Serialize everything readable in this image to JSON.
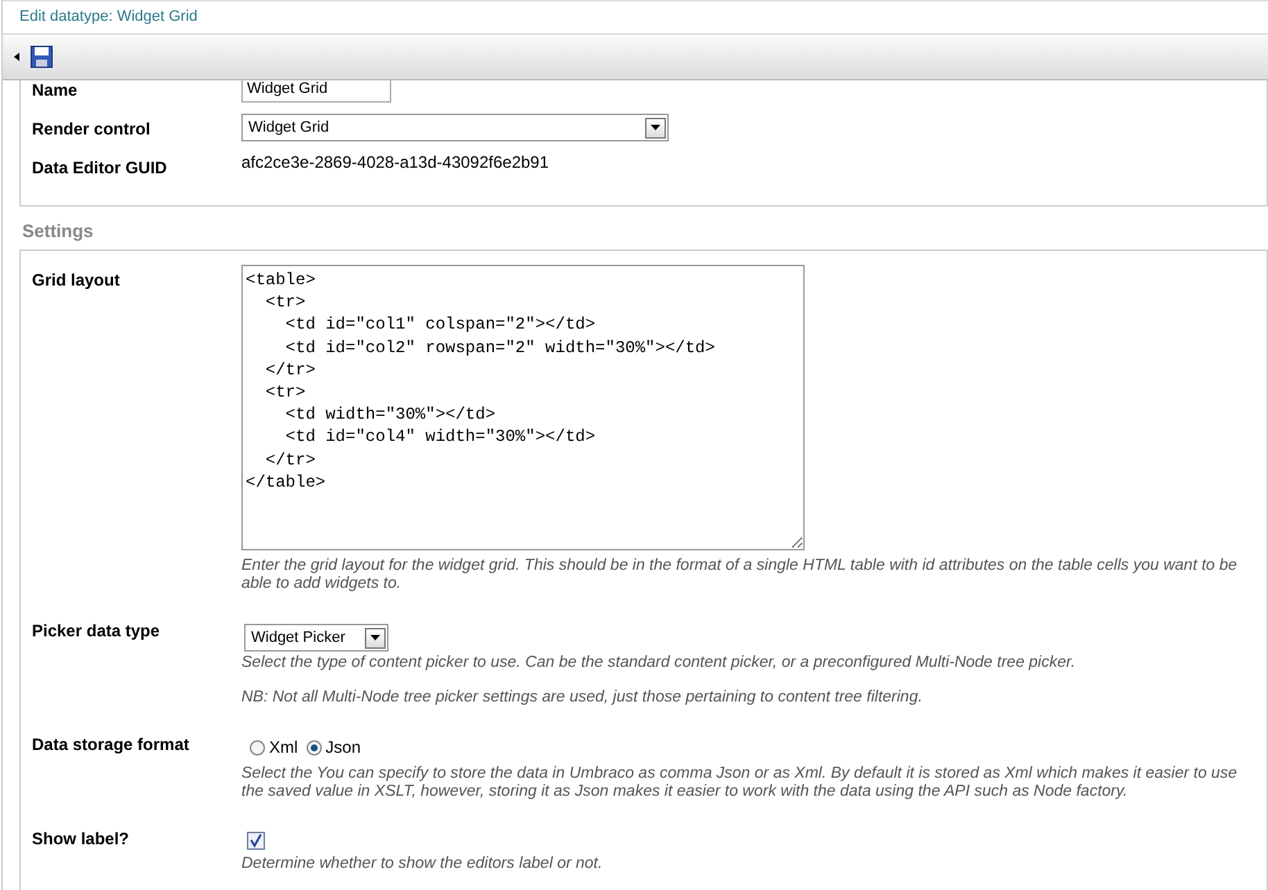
{
  "window": {
    "title": "Edit datatype: Widget Grid"
  },
  "general": [
    {
      "kind": "text",
      "label": "Name",
      "value": "Widget Grid"
    },
    {
      "kind": "select",
      "label": "Render control",
      "value": "Widget Grid"
    },
    {
      "kind": "static",
      "label": "Data Editor GUID",
      "value": "afc2ce3e-2869-4028-a13d-43092f6e2b91"
    }
  ],
  "settings": {
    "title": "Settings",
    "properties": [
      {
        "kind": "textarea",
        "label": "Grid layout",
        "value": "<table>\n  <tr>\n    <td id=\"col1\" colspan=\"2\"></td>\n    <td id=\"col2\" rowspan=\"2\" width=\"30%\"></td>\n  </tr>\n  <tr>\n    <td width=\"30%\"></td>\n    <td id=\"col4\" width=\"30%\"></td>\n  </tr>\n</table>",
        "help": [
          "Enter the grid layout for the widget grid. This should be in the format of a single HTML table with id attributes on the table cells you want to be able to add widgets to."
        ]
      },
      {
        "kind": "select",
        "label": "Picker data type",
        "value": "Widget Picker",
        "help": [
          "Select the type of content picker to use. Can be the standard content picker, or a preconfigured Multi-Node tree picker.",
          "NB: Not all Multi-Node tree picker settings are used, just those pertaining to content tree filtering."
        ]
      },
      {
        "kind": "radios",
        "label": "Data storage format",
        "options": [
          {
            "label": "Xml",
            "selected": false
          },
          {
            "label": "Json",
            "selected": true
          }
        ],
        "help": [
          "Select the You can specify to store the data in Umbraco as comma Json or as Xml. By default it is stored as Xml which makes it easier to use the saved value in XSLT, however, storing it as Json makes it easier to work with the data using the API such as Node factory."
        ]
      },
      {
        "kind": "checkbox",
        "label": "Show label?",
        "checked": true,
        "help": [
          "Determine whether to show the editors label or not."
        ]
      }
    ]
  }
}
